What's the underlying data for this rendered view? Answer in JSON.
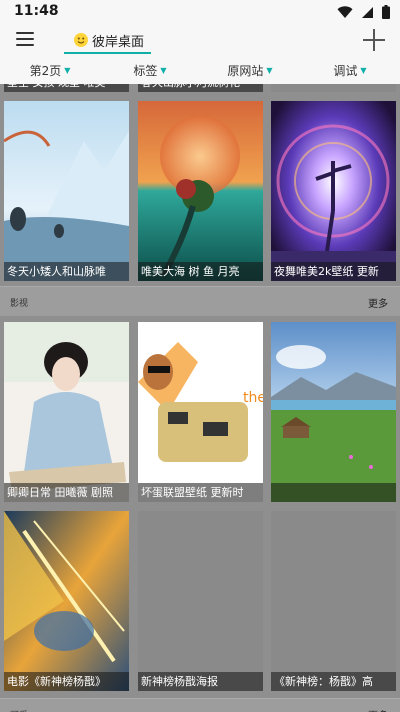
{
  "status_bar": {
    "time": "11:48"
  },
  "app_bar": {
    "title": "彼岸桌面"
  },
  "filter_bar": {
    "items": [
      "第2页",
      "标签",
      "原网站",
      "调试"
    ]
  },
  "top_partial_row": [
    "星空 女孩 观星 唯美",
    "春天山脉小河流树花"
  ],
  "wallpaper_section": {
    "cards": [
      "冬天小矮人和山脉唯",
      "唯美大海 树 鱼 月亮",
      "夜舞唯美2k壁纸 更新"
    ]
  },
  "movie_section": {
    "title": "影视",
    "more": "更多",
    "cards": [
      "卿卿日常 田曦薇 剧照",
      "坏蛋联盟壁纸 更新时",
      "",
      "电影《新神榜杨戬》",
      "新神榜杨戬海报",
      "《新神榜：杨戬》高"
    ]
  },
  "next_section": {
    "title": "可爱",
    "more": "更多"
  },
  "colors": {
    "accent": "#10b0a8",
    "background": "#8f8f8f",
    "bar": "#f7f7f7"
  }
}
